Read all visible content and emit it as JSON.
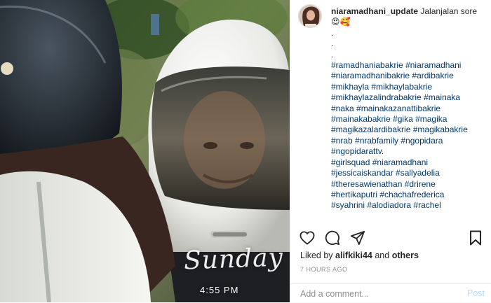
{
  "post": {
    "username": "niaramadhani_update",
    "caption_text": "Jalanjalan sore",
    "caption_emojis": "😍🥰",
    "caption_lines": [
      ".",
      ".",
      ".",
      "#ramadhaniabakrie #niaramadhani",
      "#niaramadhanibakrie #ardibakrie",
      "#mikhayla #mikhaylabakrie",
      "#mikhaylazalindrabakrie #mainaka",
      "#naka #mainakazanattibakrie",
      "#mainakabakrie #gika #magika",
      "#magikazalardibakrie #magikabakrie",
      "#nrab #nrabfamily #ngopidara",
      "#ngopidarattv.",
      "#girlsquad #niaramadhani",
      "#jessicaiskandar #sallyadelia",
      "#theresawienathan #drirene",
      "#hertikaputri #chachafrederica",
      "#syahrini #alodiadora #rachel"
    ]
  },
  "media": {
    "sticker_day": "Sunday",
    "sticker_time": "4:55 PM"
  },
  "actions": {
    "like_icon": "heart-icon",
    "comment_icon": "comment-icon",
    "share_icon": "share-icon",
    "save_icon": "bookmark-icon"
  },
  "likes": {
    "prefix": "Liked by",
    "user": "alifkiki44",
    "conjunction": "and",
    "others": "others"
  },
  "time_ago": "7 HOURS AGO",
  "comment": {
    "placeholder": "Add a comment...",
    "post_label": "Post"
  },
  "colors": {
    "link": "#00376b",
    "text": "#262626",
    "muted": "#8e8e8e",
    "post_disabled": "#b3dbff"
  }
}
